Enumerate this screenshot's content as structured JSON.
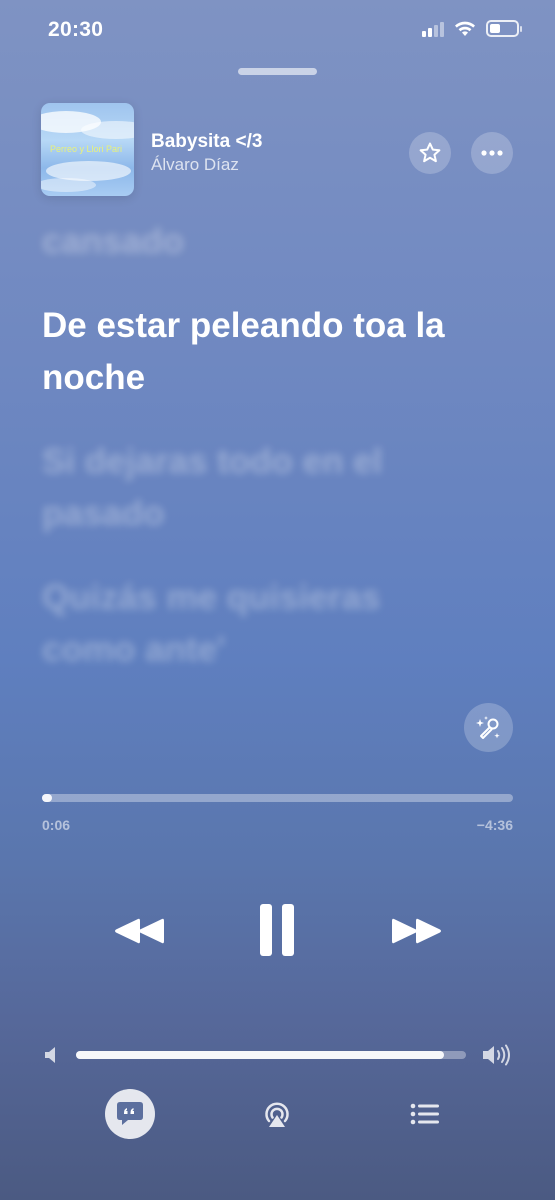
{
  "status_bar": {
    "time": "20:30"
  },
  "now_playing": {
    "artwork_text": "Perreo y Llori Pari",
    "title": "Babysita </3",
    "artist": "Álvaro Díaz",
    "favorite_icon": "star-icon",
    "more_icon": "ellipsis-icon"
  },
  "lyrics": {
    "previous": "cansado",
    "current": "De estar peleando toa la noche",
    "next_1": "Si dejaras todo en el pasado",
    "next_2": "Quizás me quisieras como ante'"
  },
  "progress": {
    "elapsed": "0:06",
    "remaining": "−4:36",
    "fraction": 0.021
  },
  "volume": {
    "fraction": 0.943
  },
  "controls": {
    "previous_icon": "rewind-icon",
    "pause_icon": "pause-icon",
    "next_icon": "fast-forward-icon",
    "sing_icon": "microphone-sparkle-icon",
    "lyrics_icon": "lyrics-quote-icon",
    "airplay_icon": "airplay-icon",
    "queue_icon": "queue-list-icon"
  }
}
